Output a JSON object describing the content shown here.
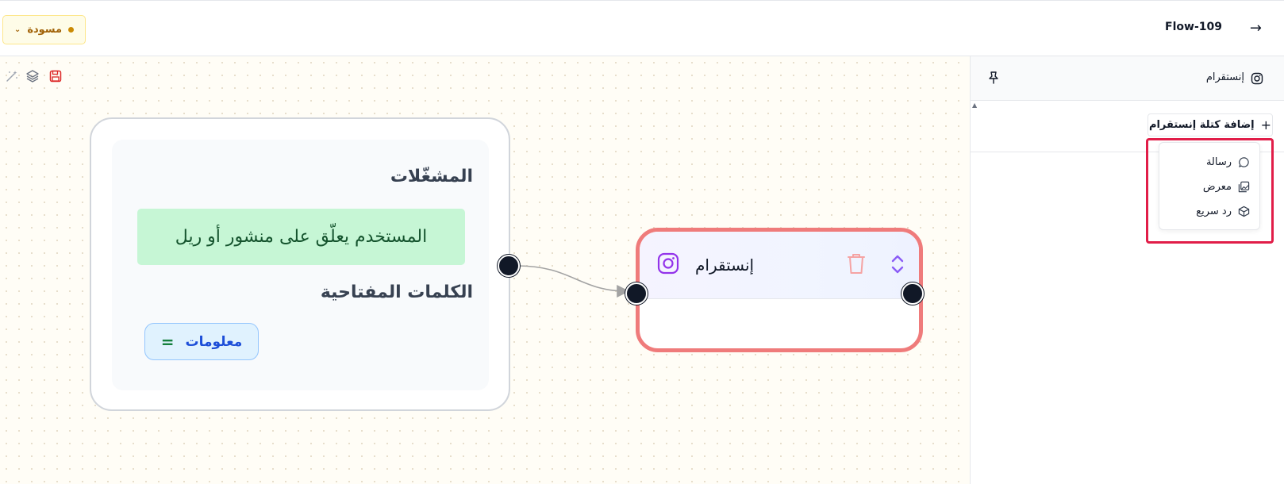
{
  "header": {
    "flow_title": "Flow-109",
    "status_label": "مسودة",
    "back_icon": "arrow-right-icon"
  },
  "canvas": {
    "tools": [
      "magic-wand-icon",
      "layers-icon",
      "save-icon"
    ],
    "trigger_card": {
      "triggers_heading": "المشغّلات",
      "trigger_text": "المستخدم يعلّق على منشور أو ريل",
      "keywords_heading": "الكلمات المفتاحية",
      "keyword_chip": "معلومات"
    },
    "instagram_node": {
      "title": "إنستقرام",
      "border_color": "#ef7b7b"
    }
  },
  "panel": {
    "title": "إنستقرام",
    "add_block_label": "إضافة كتلة إنستقرام",
    "menu_items": [
      {
        "label": "رسالة",
        "icon": "message-circle-icon"
      },
      {
        "label": "معرض",
        "icon": "gallery-icon"
      },
      {
        "label": "رد سريع",
        "icon": "box-icon"
      }
    ],
    "highlight_color": "#e11d48"
  }
}
